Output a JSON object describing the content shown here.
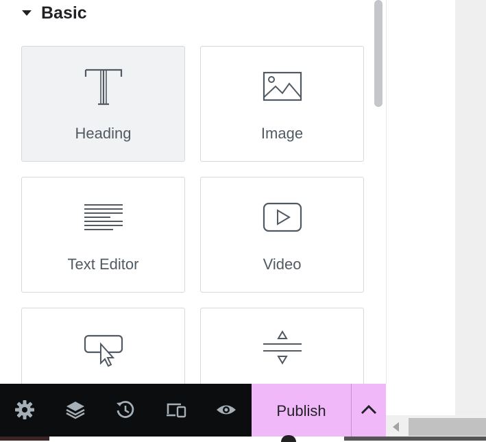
{
  "panel": {
    "section": {
      "title": "Basic",
      "icon": "caret-down-icon"
    },
    "widgets": [
      {
        "label": "Heading",
        "icon": "heading-icon",
        "active": true
      },
      {
        "label": "Image",
        "icon": "image-icon",
        "active": false
      },
      {
        "label": "Text Editor",
        "icon": "text-editor-icon",
        "active": false
      },
      {
        "label": "Video",
        "icon": "video-icon",
        "active": false
      },
      {
        "label": "",
        "icon": "button-icon",
        "active": false
      },
      {
        "label": "",
        "icon": "divider-icon",
        "active": false
      }
    ]
  },
  "footer": {
    "tools": [
      {
        "name": "settings",
        "icon": "gear-icon"
      },
      {
        "name": "navigator",
        "icon": "layers-icon"
      },
      {
        "name": "history",
        "icon": "history-icon"
      },
      {
        "name": "responsive",
        "icon": "responsive-devices-icon"
      },
      {
        "name": "preview",
        "icon": "eye-icon"
      }
    ],
    "publish_label": "Publish",
    "publish_more_icon": "chevron-up-icon",
    "publish_color": "#f0b8f8"
  },
  "colors": {
    "toolbar_bg": "#0c0d0e",
    "icon_gray": "#515962",
    "active_widget_bg": "#f1f2f3"
  }
}
